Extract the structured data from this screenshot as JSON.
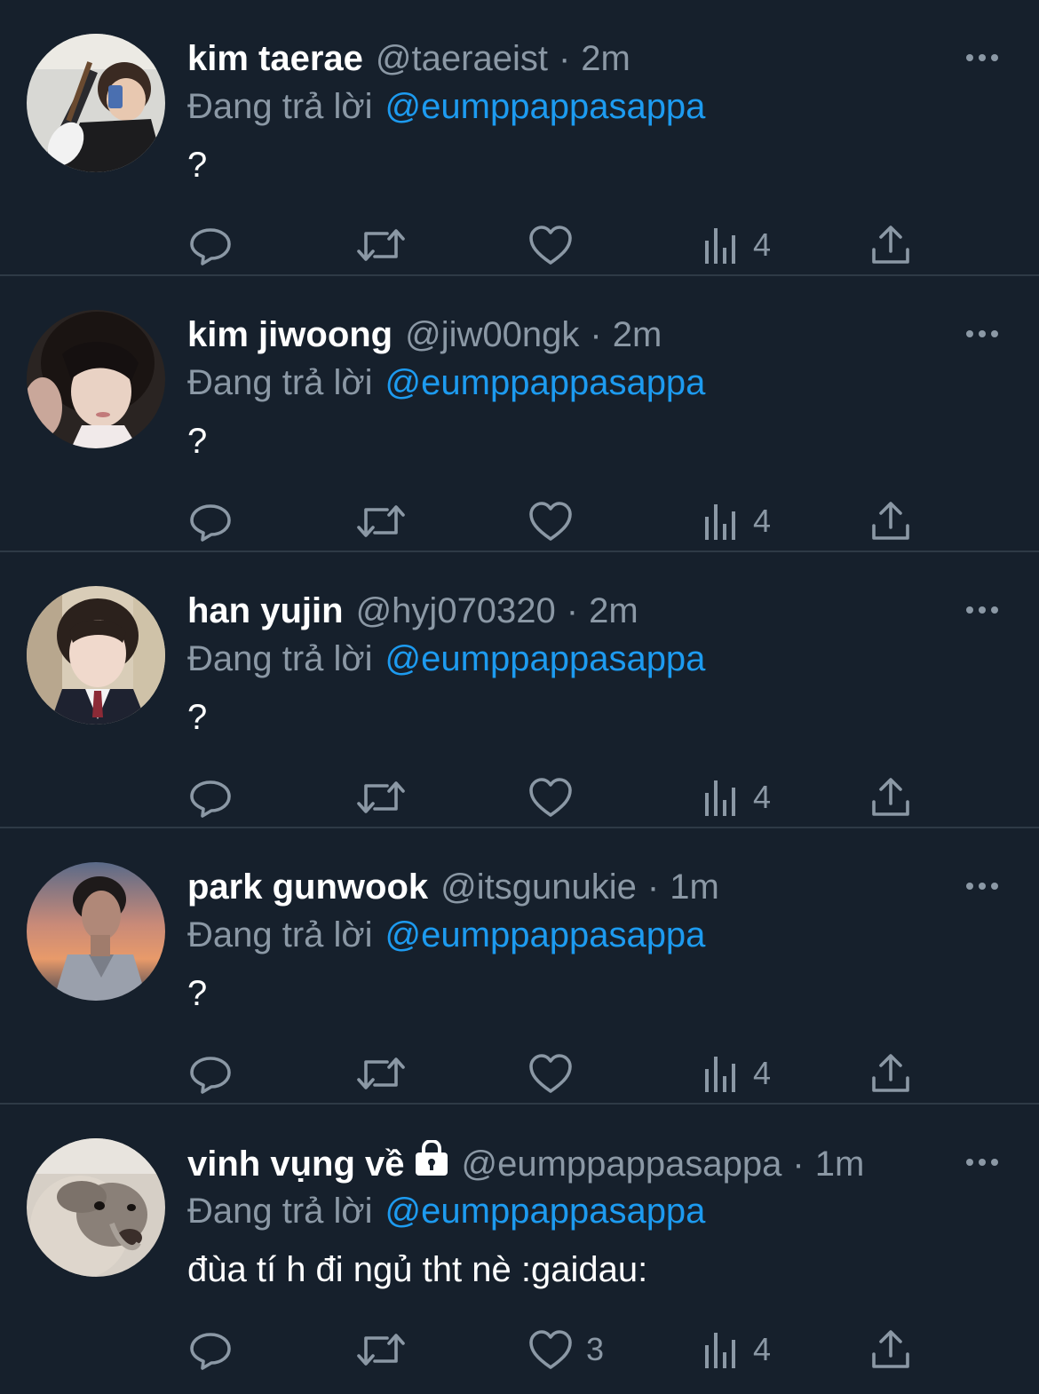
{
  "theme": {
    "background": "#16202c",
    "divider": "#2e3a46",
    "text_primary": "#ffffff",
    "text_secondary": "#8b98a5",
    "accent": "#1d9bf0"
  },
  "tweets": [
    {
      "name": "kim taerae",
      "locked": false,
      "handle": "@taeraeist",
      "separator": "·",
      "time": "2m",
      "reply_label": "Đang trả lời",
      "reply_to": "@eumppappasappa",
      "text": "?",
      "likes": "",
      "views": "4",
      "avatar": "avatar-guitar-mirror-selfie",
      "icons": [
        "more-icon",
        "reply-icon",
        "retweet-icon",
        "heart-icon",
        "views-icon",
        "share-icon"
      ]
    },
    {
      "name": "kim jiwoong",
      "locked": false,
      "handle": "@jiw00ngk",
      "separator": "·",
      "time": "2m",
      "reply_label": "Đang trả lời",
      "reply_to": "@eumppappasappa",
      "text": "?",
      "likes": "",
      "views": "4",
      "avatar": "avatar-dark-hair-portrait",
      "icons": [
        "more-icon",
        "reply-icon",
        "retweet-icon",
        "heart-icon",
        "views-icon",
        "share-icon"
      ]
    },
    {
      "name": "han yujin",
      "locked": false,
      "handle": "@hyj070320",
      "separator": "·",
      "time": "2m",
      "reply_label": "Đang trả lời",
      "reply_to": "@eumppappasappa",
      "text": "?",
      "likes": "",
      "views": "4",
      "avatar": "avatar-school-uniform",
      "icons": [
        "more-icon",
        "reply-icon",
        "retweet-icon",
        "heart-icon",
        "views-icon",
        "share-icon"
      ]
    },
    {
      "name": "park gunwook",
      "locked": false,
      "handle": "@itsgunukie",
      "separator": "·",
      "time": "1m",
      "reply_label": "Đang trả lời",
      "reply_to": "@eumppappasappa",
      "text": "?",
      "likes": "",
      "views": "4",
      "avatar": "avatar-sunset-portrait",
      "icons": [
        "more-icon",
        "reply-icon",
        "retweet-icon",
        "heart-icon",
        "views-icon",
        "share-icon"
      ]
    },
    {
      "name": "vinh vụng về",
      "locked": true,
      "handle": "@eumppappasappa",
      "separator": "·",
      "time": "1m",
      "reply_label": "Đang trả lời",
      "reply_to": "@eumppappasappa",
      "text": "đùa tí h đi ngủ tht nè :gaidau:",
      "likes": "3",
      "views": "4",
      "avatar": "avatar-greyhound-dog",
      "icons": [
        "lock-icon",
        "more-icon",
        "reply-icon",
        "retweet-icon",
        "heart-icon",
        "views-icon",
        "share-icon"
      ]
    }
  ]
}
